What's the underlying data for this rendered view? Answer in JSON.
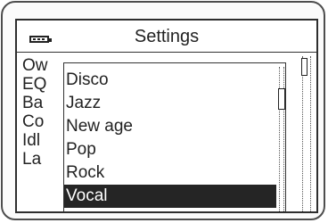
{
  "header": {
    "title": "Settings",
    "battery_icon": "battery-icon"
  },
  "menu": {
    "items": [
      {
        "label": "Ow"
      },
      {
        "label": "EQ"
      },
      {
        "label": "Ba"
      },
      {
        "label": "Co"
      },
      {
        "label": "Idl"
      },
      {
        "label": "La"
      }
    ]
  },
  "popup": {
    "items": [
      {
        "label": "Disco"
      },
      {
        "label": "Jazz"
      },
      {
        "label": "New age"
      },
      {
        "label": "Pop"
      },
      {
        "label": "Rock"
      },
      {
        "label": "Vocal"
      }
    ],
    "selected_label": "Vocal"
  },
  "colors": {
    "frame": "#4d4d4d",
    "text": "#222222",
    "selection_bg": "#252525",
    "selection_text": "#ffffff"
  }
}
